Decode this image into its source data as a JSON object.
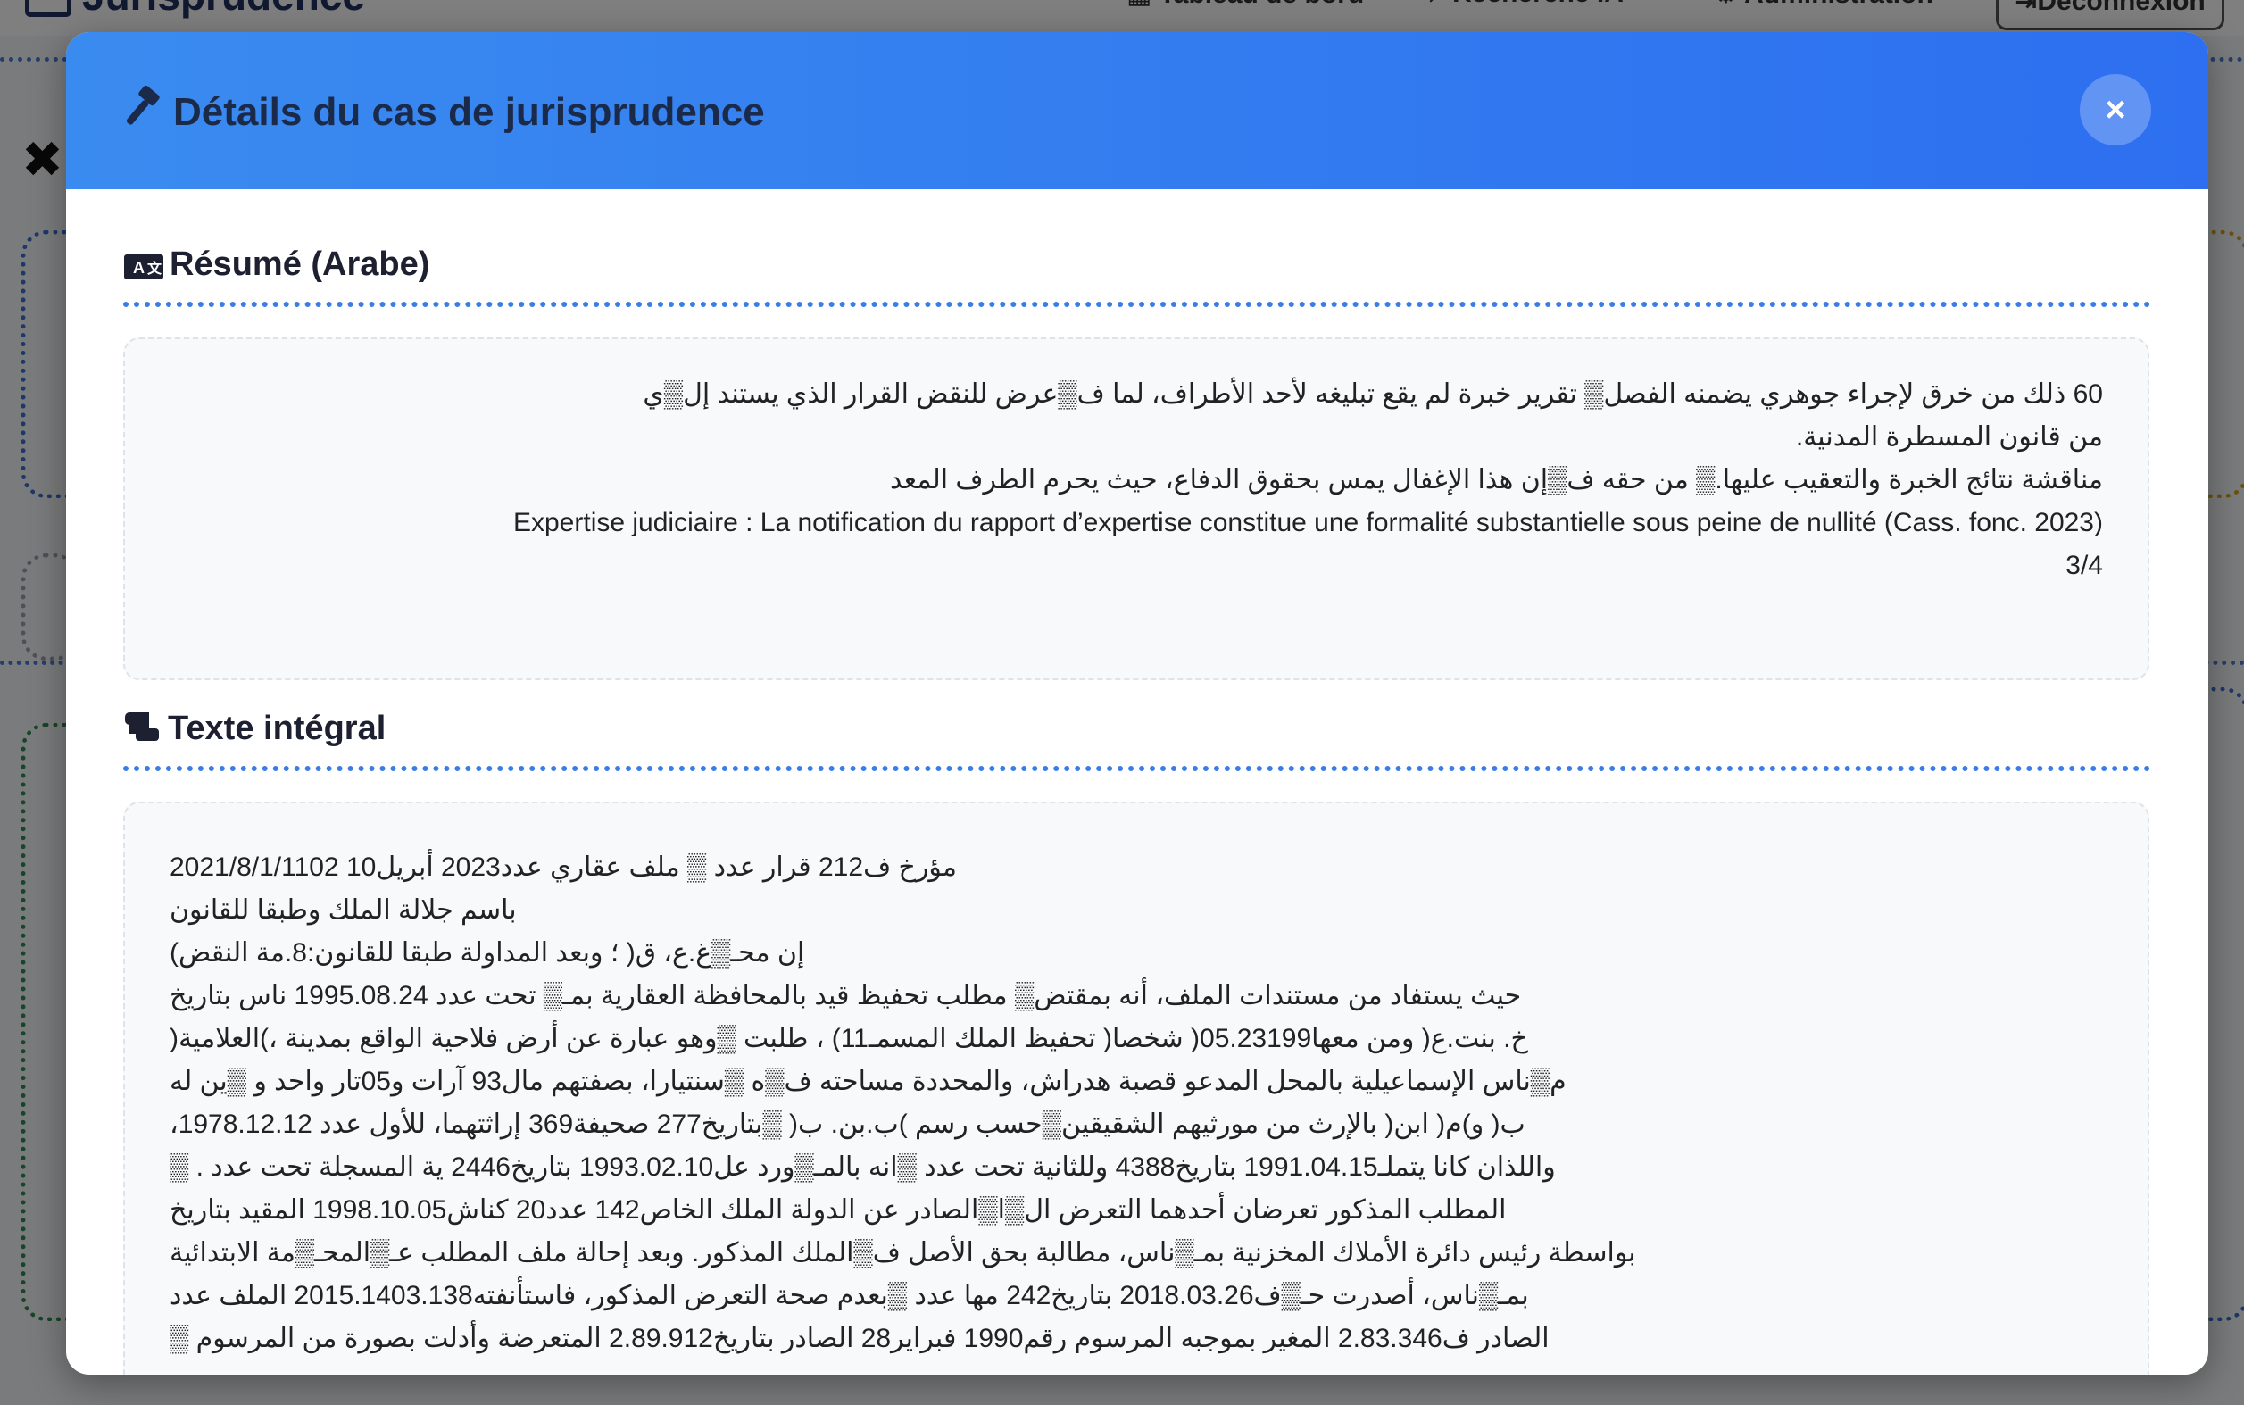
{
  "background": {
    "brand": "Jurisprudence",
    "nav": [
      "Tableau de bord",
      "Recherche IA",
      "Administration"
    ],
    "logout": "Déconnexion"
  },
  "modal": {
    "title": "Détails du cas de jurisprudence",
    "close_label": "×"
  },
  "summary": {
    "heading": "Résumé (Arabe)",
    "lines": [
      "60  ذلك من خرق لإجراء جوهري يضمنه الفصل▒ تقرير خبرة لم يقع تبليغه لأحد الأطراف، لما ف▒عرض للنقض القرار الذي يستند إل▒ي",
      "من قانون المسطرة المدنية.",
      "مناقشة نتائج الخبرة والتعقيب عليها.▒ من حقه ف▒إن هذا الإغفال يمس بحقوق الدفاع، حيث يحرم الطرف المعد",
      "Expertise judiciaire : La notification du rapport d’expertise constitue une formalité substantielle sous peine de nullité (Cass. fonc. 2023)",
      "3/4"
    ]
  },
  "full_text": {
    "heading": "Texte intégral",
    "lines": [
      "مؤرخ ف212 قرار عدد ▒ ملف عقاري عدد2023  أبريل10  2021/8/1/1102",
      "باسم جلالة الملك وطبقا للقانون",
      "إن محـ▒غ.ع، ق( ؛ وبعد المداولة طبقا للقانون:8.مة النقض)",
      "حيث يستفاد من مستندات الملف، أنه بمقتض▒ مطلب تحفيظ قيد بالمحافظة العقارية بمـ▒ تحت عدد 1995.08.24 ناس بتاريخ",
      "خ. بنت.ع( ومن معها05.23199( شخصا( تحفيظ الملك المسمـ11) ، طلبت ▒وهو عبارة عن أرض فلاحية الواقع بمدينة ،)العلامية(",
      "م▒ناس الإسماعيلية بالمحل المدعو قصبة هدراش، والمحددة مساحته ف▒ه ▒سنتيارا، بصفتهم مال93 آرات و05تار واحد و ▒ين له",
      "ب( و)م( ابن( بالإرث من مورثيهم الشقيقين▒حسب رسم )ب.بن. ب( ▒بتاريخ277  صحيفة369  إراثتهما، للأول عدد  1978.12.12،",
      "واللذان كانا يتملـ1991.04.15  بتاريخ4388 وللثانية تحت عدد ▒انه بالمـ▒ورد عل1993.02.10  بتاريخ2446 ية المسجلة تحت عدد . ▒",
      "المطلب المذكور تعرضان أحدهما التعرض ال▒ا▒الصادر عن الدولة الملك الخاص142  عدد20  كناش1998.10.05  المقيد بتاريخ",
      "بواسطة رئيس دائرة الأملاك المخزنية بمـ▒ناس، مطالبة بحق الأصل ف▒الملك المذكور. وبعد إحالة ملف المطلب عـ▒المحـ▒مة الابتدائية",
      "بمـ▒ناس، أصدرت حـ▒ف2018.03.26  بتاريخ242 مها عدد ▒بعدم صحة التعرض المذكور، فاستأنفته2015.1403.138  الملف عدد",
      "الصادر ف2.83.346  المغير بموجبه المرسوم رقم1990  فبراير28  الصادر بتاريخ2.89.912 المتعرضة وأدلت بصورة من المرسوم ▒"
    ]
  }
}
